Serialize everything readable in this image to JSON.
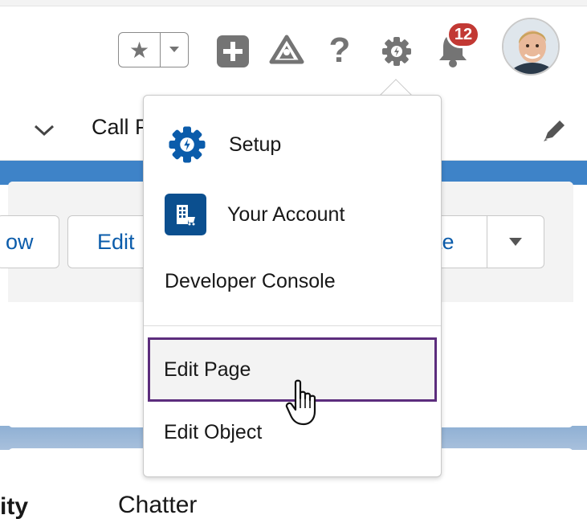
{
  "header": {
    "notification_count": "12",
    "icons": [
      "star-icon",
      "chevron-down-icon",
      "plus-icon",
      "trailhead-icon",
      "help-icon",
      "gear-icon",
      "bell-icon",
      "avatar"
    ]
  },
  "nav": {
    "tab_label": "Call P",
    "icons": [
      "chevron-down-icon",
      "pencil-icon"
    ]
  },
  "record_actions": {
    "follow_label": "ow",
    "edit_label": "Edit",
    "right_label": "te"
  },
  "lower_tabs": {
    "activity_label": "ity",
    "chatter_label": "Chatter"
  },
  "setup_menu": {
    "items": [
      {
        "label": "Setup",
        "icon": "setup-gear-icon"
      },
      {
        "label": "Your Account",
        "icon": "account-building-icon"
      },
      {
        "label": "Developer Console"
      },
      {
        "label": "Edit Page"
      },
      {
        "label": "Edit Object"
      }
    ],
    "highlighted_item": "Edit Page"
  },
  "colors": {
    "brand_blue": "#0b5cab",
    "highlight_border": "#5c2d7d",
    "badge_red": "#c23934",
    "icon_gray": "#747474"
  }
}
